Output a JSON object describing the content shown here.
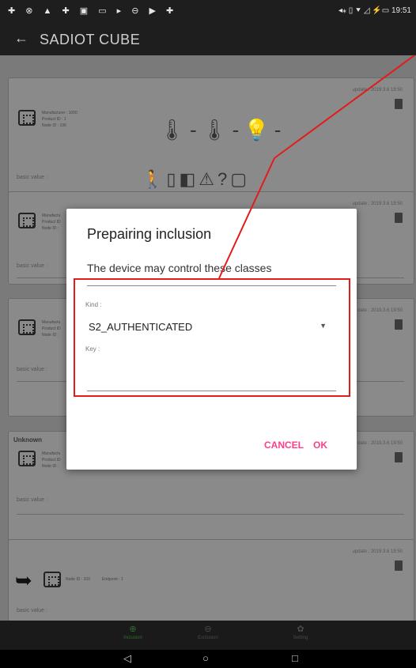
{
  "status_bar": {
    "left_icons": "✚ ⊗ ▲ ✚ ▣ ▭ ▸ ⊖ ▶ ✚",
    "right_text": "◂⁎ ▯ ⯆ ◿ ⚡▭ 19:51"
  },
  "app_bar": {
    "back_icon": "←",
    "title": "SADIOT CUBE"
  },
  "cards": [
    {
      "update": "update : 2019.3.6 19:50",
      "meta": [
        "Manufacturer : 1000",
        "Product ID : 1",
        "Node ID : 196"
      ],
      "sensors": "🌡-🌡-💡-",
      "icons": "🚶▯◧⚠?▢",
      "basic_value_label": "basic value :"
    },
    {
      "update": "update : 2019.3.6 19:50",
      "meta": [
        "Manufactu",
        "Product ID",
        "Node ID :"
      ],
      "basic_value_label": "basic value :"
    },
    {
      "update": "date : 2019.3.6 19:50",
      "meta": [
        "Manufactu",
        "Product ID",
        "Node ID :"
      ],
      "basic_value_label": "basic value :"
    },
    {
      "unknown_label": "Unknown",
      "update": "date : 2019.3.6 19:50",
      "meta": [
        "Manufactu",
        "Product ID",
        "Node ID :"
      ],
      "basic_value_label": "basic value :"
    },
    {
      "update": "update : 2019.3.6 19:50",
      "node_text": "Node ID : 103",
      "endpoint_text": "Endpoint : 1",
      "arrow_icon": "➥",
      "basic_value_label": "basic value :"
    }
  ],
  "dialog": {
    "title": "Prepairing inclusion",
    "message": "The device may control these classes",
    "kind_label": "Kind :",
    "kind_value": "S2_AUTHENTICATED",
    "kind_arrow": "▼",
    "key_label": "Key :",
    "key_value": "",
    "cancel_label": "CANCEL",
    "ok_label": "OK"
  },
  "bottom_nav": [
    {
      "icon": "⊕",
      "label": "Inclusion"
    },
    {
      "icon": "⊖",
      "label": "Exclusion"
    },
    {
      "icon": "✿",
      "label": "Setting"
    }
  ],
  "system_nav": {
    "back": "◁",
    "home": "○",
    "recents": "□"
  },
  "colors": {
    "accent": "#ff3d8b",
    "annotation": "#e21b1b",
    "bar": "#1e1e1e",
    "active_nav": "#2f6e2f"
  }
}
